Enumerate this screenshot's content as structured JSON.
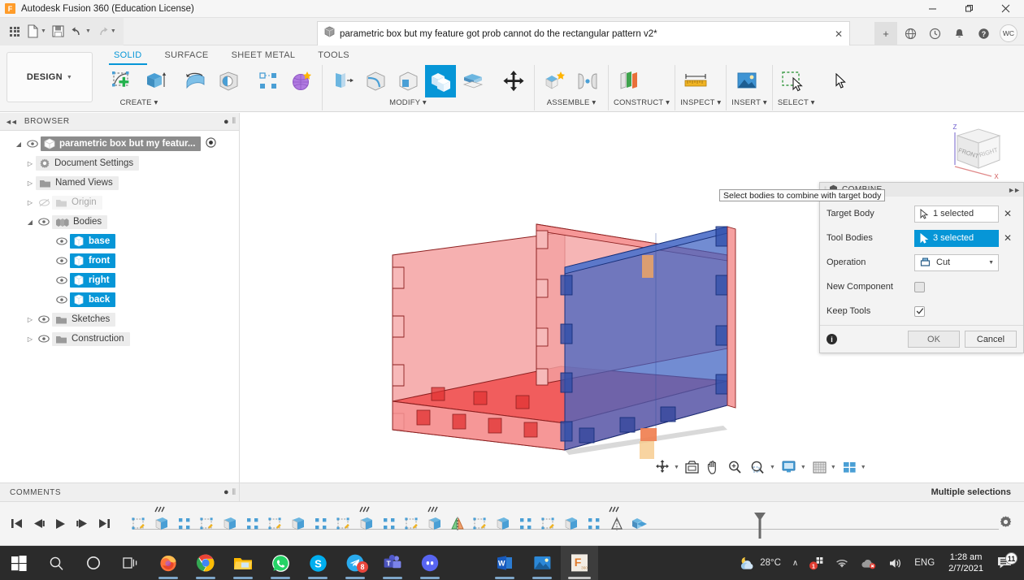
{
  "window": {
    "title": "Autodesk Fusion 360 (Education License)",
    "logo_letter": "F",
    "minimize": "–",
    "maximize": "❐",
    "close": "✕"
  },
  "quick_access": {
    "app_grid_icon": "app-grid-icon",
    "new_icon": "new-document-icon",
    "save_icon": "save-icon",
    "undo_icon": "undo-icon",
    "redo_icon": "redo-icon"
  },
  "document_tab": {
    "title": "parametric box but my feature got prob cannot do the rectangular pattern v2*",
    "close": "✕",
    "add_tab": "+"
  },
  "top_right": {
    "globe_icon": "globe-icon",
    "history_icon": "clock-history-icon",
    "bell_icon": "notification-bell-icon",
    "help_icon": "help-icon",
    "avatar_initials": "WC"
  },
  "ribbon": {
    "workspace": "DESIGN",
    "tabs": [
      {
        "label": "SOLID",
        "active": true
      },
      {
        "label": "SURFACE",
        "active": false
      },
      {
        "label": "SHEET METAL",
        "active": false
      },
      {
        "label": "TOOLS",
        "active": false
      }
    ],
    "panels": [
      {
        "label": "CREATE ▾",
        "name": "create-panel"
      },
      {
        "label": "MODIFY ▾",
        "name": "modify-panel"
      },
      {
        "label": "ASSEMBLE ▾",
        "name": "assemble-panel"
      },
      {
        "label": "CONSTRUCT ▾",
        "name": "construct-panel"
      },
      {
        "label": "INSPECT ▾",
        "name": "inspect-panel"
      },
      {
        "label": "INSERT ▾",
        "name": "insert-panel"
      },
      {
        "label": "SELECT ▾",
        "name": "select-panel"
      }
    ]
  },
  "browser": {
    "title": "BROWSER",
    "root": "parametric box but my featur...",
    "items": [
      {
        "label": "Document Settings",
        "icon": "gear-icon",
        "indent": 1,
        "twist": "▷",
        "eye": false,
        "dim": false
      },
      {
        "label": "Named Views",
        "icon": "folder-icon",
        "indent": 1,
        "twist": "▷",
        "eye": false,
        "dim": false
      },
      {
        "label": "Origin",
        "icon": "folder-icon",
        "indent": 1,
        "twist": "▷",
        "eye": true,
        "dim": true
      },
      {
        "label": "Bodies",
        "icon": "bodies-icon",
        "indent": 1,
        "twist": "◢",
        "eye": true,
        "dim": false
      },
      {
        "label": "base",
        "icon": "body-icon",
        "indent": 2,
        "twist": "",
        "eye": true,
        "selected": true
      },
      {
        "label": "front",
        "icon": "body-icon",
        "indent": 2,
        "twist": "",
        "eye": true,
        "selected": true
      },
      {
        "label": "right",
        "icon": "body-icon",
        "indent": 2,
        "twist": "",
        "eye": true,
        "selected": true
      },
      {
        "label": "back",
        "icon": "body-icon",
        "indent": 2,
        "twist": "",
        "eye": true,
        "selected": true
      },
      {
        "label": "Sketches",
        "icon": "folder-icon",
        "indent": 1,
        "twist": "▷",
        "eye": true,
        "dim": false
      },
      {
        "label": "Construction",
        "icon": "folder-icon",
        "indent": 1,
        "twist": "▷",
        "eye": true,
        "dim": false
      }
    ]
  },
  "dialog": {
    "title": "COMBINE",
    "tooltip": "Select bodies to combine with target body",
    "rows": {
      "target_body_label": "Target Body",
      "target_body_value": "1 selected",
      "tool_bodies_label": "Tool Bodies",
      "tool_bodies_value": "3 selected",
      "operation_label": "Operation",
      "operation_value": "Cut",
      "new_component_label": "New Component",
      "new_component_checked": false,
      "keep_tools_label": "Keep Tools",
      "keep_tools_checked": true
    },
    "ok": "OK",
    "cancel": "Cancel",
    "clear_icon": "✕"
  },
  "viewcube": {
    "front_face": "FRONT",
    "right_face": "RIGHT",
    "axis_z": "Z",
    "axis_x": "X"
  },
  "navbar": {
    "items": [
      {
        "name": "orbit-icon",
        "caret": true
      },
      {
        "name": "look-at-icon",
        "caret": false
      },
      {
        "name": "pan-icon",
        "caret": false
      },
      {
        "name": "zoom-icon",
        "caret": false
      },
      {
        "name": "fit-icon",
        "caret": true
      },
      {
        "name": "display-settings-icon",
        "caret": true
      },
      {
        "name": "grid-snaps-icon",
        "caret": true
      },
      {
        "name": "viewports-icon",
        "caret": true
      }
    ]
  },
  "status": {
    "comments": "COMMENTS",
    "selection_text": "Multiple selections"
  },
  "timeline": {
    "controls": [
      "jump-start",
      "step-back",
      "play",
      "step-forward",
      "jump-end"
    ],
    "features": [
      "sketch",
      "extrude",
      "pattern",
      "sketch",
      "extrude",
      "pattern",
      "sketch",
      "extrude",
      "pattern",
      "sketch",
      "extrude",
      "pattern",
      "sketch",
      "extrude",
      "mirror",
      "sketch",
      "extrude",
      "pattern",
      "sketch",
      "extrude",
      "pattern",
      "combine"
    ],
    "settings_icon": "gear-icon"
  },
  "taskbar": {
    "apps": [
      {
        "name": "windows-start-icon",
        "label": "Start"
      },
      {
        "name": "search-icon",
        "label": "Search"
      },
      {
        "name": "cortana-icon",
        "label": "Cortana"
      },
      {
        "name": "task-view-icon",
        "label": "Task View"
      },
      {
        "name": "firefox-icon",
        "label": "Firefox"
      },
      {
        "name": "chrome-icon",
        "label": "Chrome"
      },
      {
        "name": "file-explorer-icon",
        "label": "File Explorer"
      },
      {
        "name": "whatsapp-icon",
        "label": "WhatsApp"
      },
      {
        "name": "skype-icon",
        "label": "Skype"
      },
      {
        "name": "telegram-icon",
        "label": "Telegram",
        "badge": "8"
      },
      {
        "name": "teams-icon",
        "label": "Microsoft Teams"
      },
      {
        "name": "discord-icon",
        "label": "Discord"
      },
      {
        "name": "word-icon",
        "label": "Microsoft Word"
      },
      {
        "name": "photos-icon",
        "label": "Photos"
      },
      {
        "name": "fusion360-icon",
        "label": "Autodesk Fusion 360"
      }
    ],
    "tray": {
      "weather_temp": "28°C",
      "weather_icon": "partly-cloudy-night-icon",
      "chevron": "∧",
      "language": "ENG",
      "time": "1:28 am",
      "date": "2/7/2021",
      "notification_count": "11"
    }
  },
  "colors": {
    "accent_blue": "#0696d7",
    "tool_body_red": "#ef4a4a",
    "target_body_blue": "#3b5fc0",
    "taskbar": "#2b2b2b"
  }
}
